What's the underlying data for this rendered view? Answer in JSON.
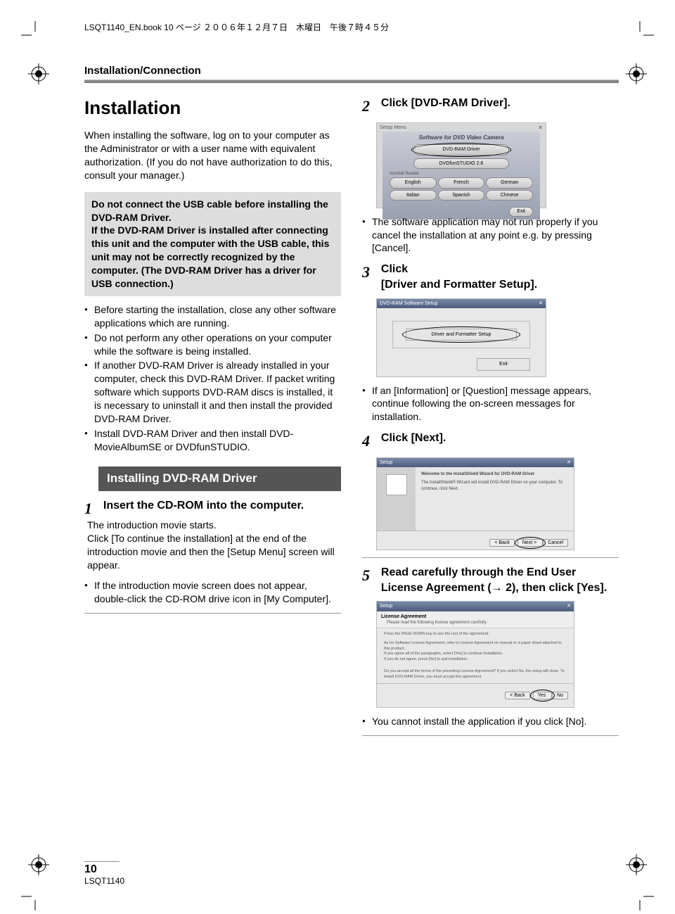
{
  "header": "LSQT1140_EN.book  10 ページ  ２００６年１２月７日　木曜日　午後７時４５分",
  "section_label": "Installation/Connection",
  "left": {
    "title": "Installation",
    "intro": "When installing the software, log on to your computer as the Administrator or with a user name with equivalent authorization. (If you do not have authorization to do this, consult your manager.)",
    "graybox": "Do not connect the USB cable before installing the DVD-RAM Driver.\nIf the DVD-RAM Driver is installed after connecting this unit and the computer with the USB cable, this unit may not be correctly recognized by the computer. (The DVD-RAM Driver has a driver for USB connection.)",
    "bullets": [
      "Before starting the installation, close any other software applications which are running.",
      "Do not perform any other operations on your computer while the software is being installed.",
      "If another DVD-RAM Driver is already installed in your computer, check this DVD-RAM Driver. If packet writing software which supports DVD-RAM discs is installed, it is necessary to uninstall it and then install the provided DVD-RAM Driver.",
      "Install DVD-RAM Driver and then install DVD-MovieAlbumSE or DVDfunSTUDIO."
    ],
    "subheading": "Installing DVD-RAM Driver",
    "step1_label": "Insert the CD-ROM into the computer.",
    "step1_body": "The introduction movie starts.\nClick [To continue the installation] at the end of the introduction movie and then the [Setup Menu] screen will appear.",
    "step1_bullet": "If the introduction movie screen does not appear, double-click the CD-ROM drive icon in [My Computer]."
  },
  "right": {
    "step2_label": "Click [DVD-RAM Driver].",
    "menu_title": "Software for DVD Video Camera",
    "menu_btn1": "DVD-RAM Driver",
    "menu_btn2": "DVDfunSTUDIO 2.6",
    "menu_acrobat": "Acrobat Reader",
    "menu_langs": [
      "English",
      "French",
      "German",
      "Italian",
      "Spanish",
      "Chinese"
    ],
    "menu_setup": "Setup Menu",
    "menu_exit": "Exit",
    "step2_bullet": "The software application may not run properly if you cancel the installation at any point e.g. by pressing [Cancel].",
    "step3_label": "Click\n[Driver and Formatter Setup].",
    "setup_title": "DVD-RAM Software Setup",
    "setup_btn1": "Driver and Formatter Setup",
    "setup_btn2": "Exit",
    "step3_bullet": "If an [Information] or [Question] message appears, continue following the on-screen messages for installation.",
    "step4_label": "Click [Next].",
    "wizard_title": "Setup",
    "wizard_heading": "Welcome to the InstallShield Wizard for DVD-RAM Driver",
    "wizard_text": "The InstallShield® Wizard will install DVD-RAM Driver on your computer. To continue, click Next.",
    "wizard_back": "< Back",
    "wizard_next": "Next >",
    "wizard_cancel": "Cancel",
    "step5_label": "Read carefully through the End User License Agreement (→ 2), then click [Yes].",
    "eula_title": "Setup",
    "eula_heading": "License Agreement",
    "eula_sub": "Please read the following license agreement carefully.",
    "eula_text1": "Press the PAGE DOWN key to see the rest of the agreement.",
    "eula_text2": "As for Software License Agreement, refer to License Agreement on manual or a paper sheet attached to this product.\nIf you agree all of the paragraphs, select [Yes] to continue Installation.\nIf you do not agree, press [No] to quit installation.",
    "eula_text3": "Do you accept all the terms of the preceding License Agreement? If you select No, the setup will close. To install DVD-RAM Driver, you must accept this agreement.",
    "eula_back": "< Back",
    "eula_yes": "Yes",
    "eula_no": "No",
    "step5_bullet": "You cannot install the application if you click [No]."
  },
  "footer": {
    "page": "10",
    "doc": "LSQT1140"
  }
}
